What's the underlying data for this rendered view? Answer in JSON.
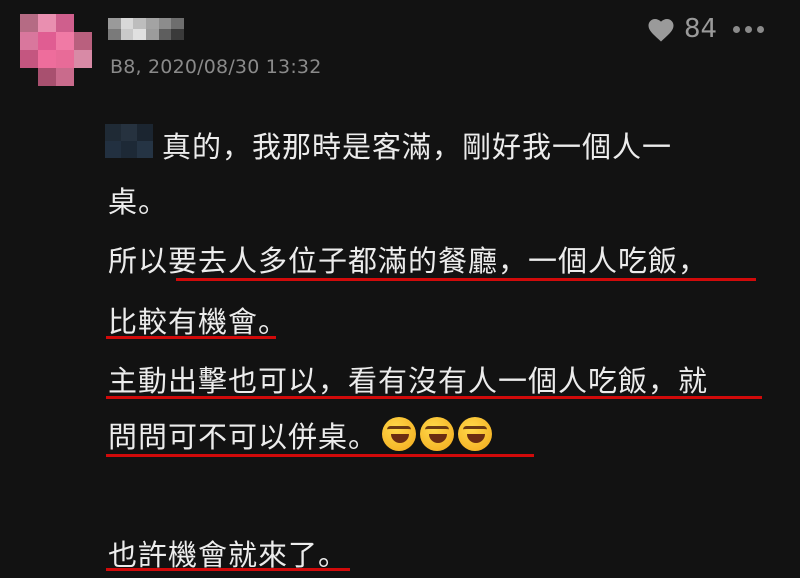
{
  "post": {
    "floor_meta": "B8, 2020/08/30 13:32",
    "like_count": "84"
  },
  "body": {
    "lines": [
      "真的，我那時是客滿，剛好我一個人一",
      "桌。",
      "所以要去人多位子都滿的餐廳，一個人吃飯，",
      "比較有機會。",
      "主動出擊也可以，看有沒有人一個人吃飯，就",
      "問問可不可以併桌。",
      "也許機會就來了。"
    ]
  },
  "colors": {
    "background": "#121212",
    "underline": "#d10a0a",
    "meta_text": "#8a8a8a"
  },
  "icons": {
    "like": "heart-icon",
    "more": "more-horizontal-icon",
    "emoji": "rolling-on-floor-laughing-emoji"
  }
}
